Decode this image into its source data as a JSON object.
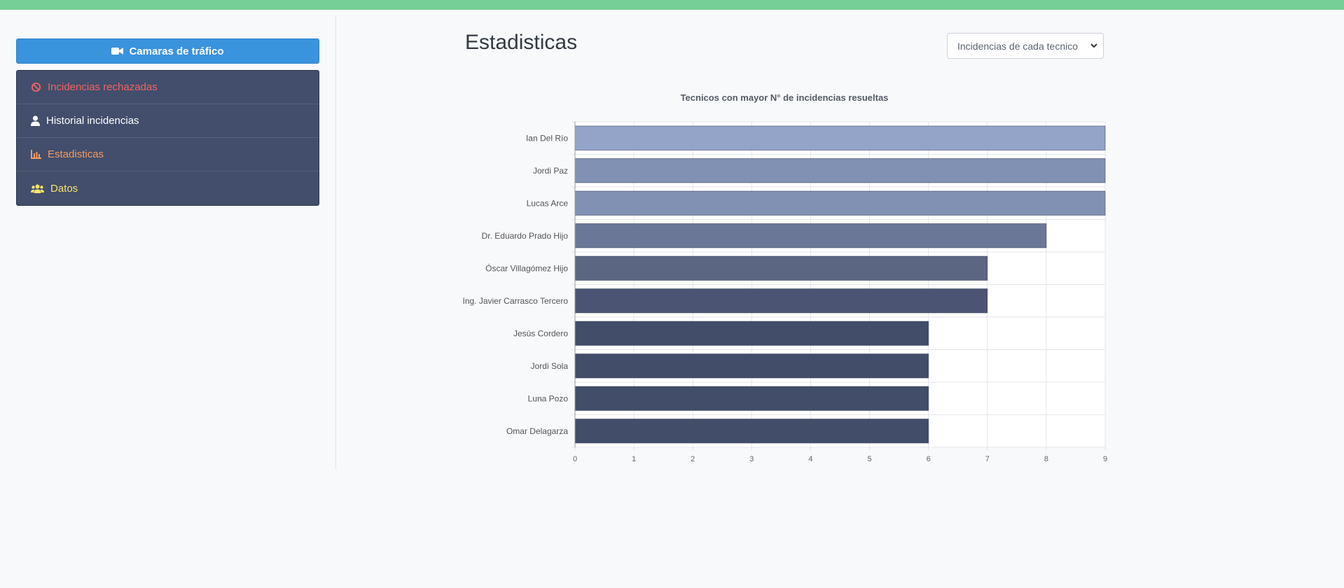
{
  "sidebar": {
    "camera_button": {
      "label": "Camaras de tráfico",
      "icon": "video-camera-icon"
    },
    "items": [
      {
        "label": "Incidencias rechazadas",
        "icon": "ban-icon",
        "color": "#f26262"
      },
      {
        "label": "Historial incidencias",
        "icon": "user-icon",
        "color": "#ffffff"
      },
      {
        "label": "Estadisticas",
        "icon": "chart-area-icon",
        "color": "#f59a5e"
      },
      {
        "label": "Datos",
        "icon": "users-icon",
        "color": "#f3e26a"
      }
    ]
  },
  "main": {
    "title": "Estadisticas",
    "select": {
      "value": "Incidencias de cada tecnico",
      "icon": "chevron-down-icon"
    }
  },
  "colors": {
    "topbar": "#76cf95",
    "primary": "#3a93dd",
    "sidebar_bg": "#424e6b"
  },
  "chart_data": {
    "type": "bar",
    "orientation": "horizontal",
    "title": "Tecnicos con mayor N° de incidencias resueltas",
    "categories": [
      "Ian Del Río",
      "Jordi Paz",
      "Lucas Arce",
      "Dr. Eduardo Prado Hijo",
      "Óscar Villagómez Hijo",
      "Ing. Javier Carrasco Tercero",
      "Jesús Cordero",
      "Jordi Sola",
      "Luna Pozo",
      "Omar Delagarza"
    ],
    "values": [
      9,
      9,
      9,
      8,
      7,
      7,
      6,
      6,
      6,
      6
    ],
    "bar_colors": [
      "#94a4c9",
      "#8191b4",
      "#8191b4",
      "#6b7796",
      "#5b6683",
      "#4b5573",
      "#424d6a",
      "#424d6a",
      "#424d6a",
      "#424d6a"
    ],
    "xlim": [
      0,
      9
    ],
    "xticks": [
      "0",
      "1",
      "2",
      "3",
      "4",
      "5",
      "6",
      "7",
      "8",
      "9"
    ],
    "grid": true,
    "legend": "none"
  }
}
